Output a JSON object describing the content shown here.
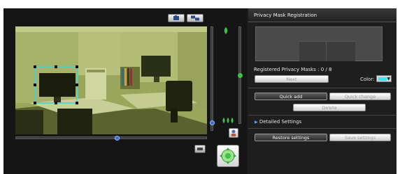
{
  "toolbar": {
    "snapshot_icon": "camera-capture-icon",
    "multiscreen_icon": "multiscreen-icon"
  },
  "video": {
    "scene": "office-camera-view",
    "tint": "#8e9b52",
    "mask_outline_color": "#39d6e0"
  },
  "sliders": {
    "vertical_position": 0.92,
    "zoom_level": 0.5,
    "horizontal_position": 0.53,
    "knob_color": "#3a6dd8",
    "zoom_knob_color": "#3fc14a"
  },
  "controls": {
    "focus_icon": "focus-icon",
    "zoom_in_icon": "zoom-in-icon",
    "zoom_out_icon": "zoom-out-icon",
    "preset_icon": "preset-user-icon",
    "small_icon": "resize-icon",
    "ptz_icon": "pan-tilt-icon"
  },
  "panel": {
    "title": "Privacy Mask Registration",
    "registered_label": "Registered Privacy Masks : 0 / 8",
    "next_label": "Next",
    "color_label": "Color:",
    "color_value": "#3fe3f0",
    "quick_add_label": "Quick add",
    "quick_change_label": "Quick change",
    "delete_label": "Delete",
    "detailed_settings_label": "Detailed Settings",
    "restore_label": "Restore settings",
    "save_label": "Save settings"
  }
}
